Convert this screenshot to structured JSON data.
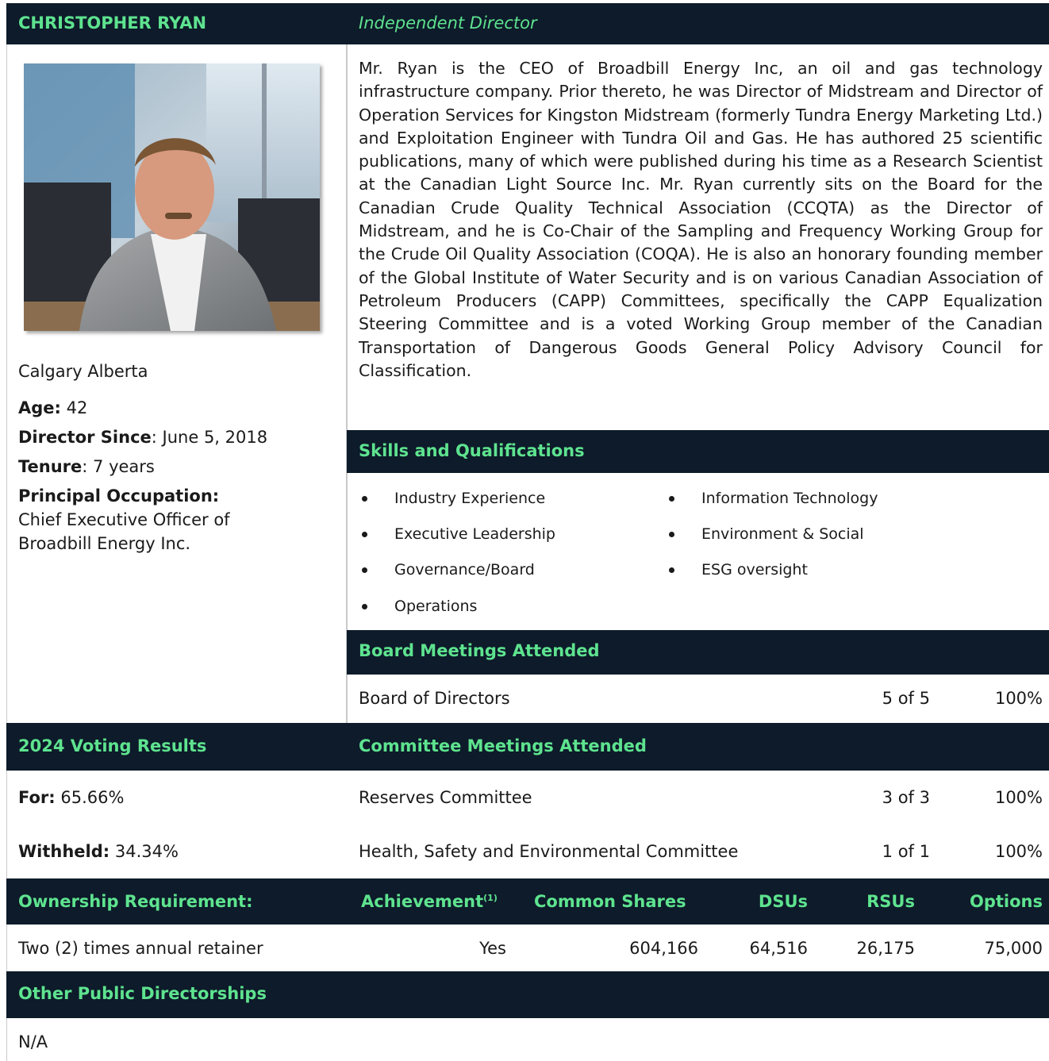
{
  "header": {
    "name": "CHRISTOPHER RYAN",
    "role": "Independent Director"
  },
  "profile": {
    "location": "Calgary Alberta",
    "age_label": "Age:",
    "age_value": " 42",
    "director_since_label": "Director Since",
    "director_since_value": ": June 5, 2018",
    "tenure_label": "Tenure",
    "tenure_value": ": 7 years",
    "occupation_label": "Principal Occupation:",
    "occupation_value": "Chief Executive Officer of Broadbill Energy Inc."
  },
  "bio": "Mr. Ryan is the CEO of Broadbill Energy Inc, an oil and gas technology infrastructure company. Prior thereto, he was Director of Midstream and Director of Operation Services for Kingston Midstream (formerly Tundra Energy Marketing Ltd.) and Exploitation Engineer with Tundra Oil and Gas. He has authored 25 scientific publications, many of which were published during his time as a Research Scientist at the Canadian Light Source Inc. Mr. Ryan currently sits on the Board for the Canadian Crude Quality Technical Association (CCQTA) as the Director of Midstream, and he is Co-Chair of the Sampling and Frequency Working Group for the Crude Oil Quality Association (COQA). He is also an honorary founding member of the Global Institute of Water Security and is on various Canadian Association of Petroleum Producers (CAPP) Committees, specifically the CAPP Equalization Steering Committee and is a voted Working Group member of the Canadian Transportation of Dangerous Goods General Policy Advisory Council for Classification.",
  "skills": {
    "title": "Skills and Qualifications",
    "col1": [
      "Industry Experience",
      "Executive Leadership",
      "Governance/Board",
      "Operations"
    ],
    "col2": [
      "Information Technology",
      "Environment & Social",
      "ESG oversight"
    ]
  },
  "board": {
    "title": "Board Meetings Attended",
    "rows": [
      {
        "name": "Board of Directors",
        "count": "5 of 5",
        "pct": "100%"
      }
    ]
  },
  "voting": {
    "title": "2024 Voting Results",
    "for_label": "For:",
    "for_value": " 65.66%",
    "withheld_label": "Withheld:",
    "withheld_value": " 34.34%"
  },
  "committee": {
    "title": "Committee Meetings Attended",
    "rows": [
      {
        "name": "Reserves Committee",
        "count": "3 of 3",
        "pct": "100%"
      },
      {
        "name": "Health, Safety and Environmental Committee",
        "count": "1 of 1",
        "pct": "100%"
      }
    ]
  },
  "ownership": {
    "headers": {
      "requirement": "Ownership Requirement:",
      "achievement": "Achievement",
      "achievement_note": "(1)",
      "common": "Common Shares",
      "dsus": "DSUs",
      "rsus": "RSUs",
      "options": "Options"
    },
    "values": {
      "requirement": "Two (2) times annual retainer",
      "achievement": "Yes",
      "common": "604,166",
      "dsus": "64,516",
      "rsus": "26,175",
      "options": "75,000"
    }
  },
  "directorships": {
    "title": "Other Public Directorships",
    "value": "N/A"
  },
  "colors": {
    "navy": "#0d1b2a",
    "accent_green": "#5ee38f"
  }
}
